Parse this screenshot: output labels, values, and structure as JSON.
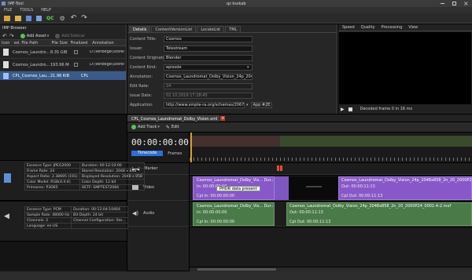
{
  "window": {
    "title": "IMF-Tool",
    "center_title": "qz ksskab"
  },
  "menu": [
    "FILE",
    "TOOLS",
    "HELP"
  ],
  "imp_browser": {
    "title": "IMP Browser",
    "add_asset": "Add Asset",
    "add_sidecar": "Add Sidecar",
    "columns": [
      "Icon",
      "ed. File Path",
      "File Size",
      "Finalized",
      "Annotation"
    ],
    "rows": [
      {
        "name": "Cosmos_Laundro...",
        "size": "8.35 GiB",
        "annotation": "D:\\Verbege\\Store\\Cosmos_Laundromat"
      },
      {
        "name": "Cosmos_Laundro...",
        "size": "193.96 MiB",
        "annotation": "D:\\Verbege\\Store\\Cosmos_Laundromat"
      },
      {
        "name": "CPL_Cosmos_Lau...",
        "size": "21.96 KiB",
        "annotation": "CPL"
      }
    ]
  },
  "details": {
    "tabs": [
      "Details",
      "ContentVersionList",
      "LocaleList",
      "TML"
    ],
    "fields": [
      {
        "label": "Content Title:",
        "value": "Cosmos"
      },
      {
        "label": "Issuer:",
        "value": "Telestream"
      },
      {
        "label": "Content Originator:",
        "value": "Blender"
      },
      {
        "label": "Content Kind:",
        "value": "episode"
      },
      {
        "label": "Annotation:",
        "value": "Cosmos_Laundromat_Dolby_Vision_24p_2048x858"
      },
      {
        "label": "Edit Rate:",
        "value": "24"
      },
      {
        "label": "Issue Date:",
        "value": "02.10.2019 17:28:45"
      },
      {
        "label": "Application:",
        "value": "http://www.smpte-ra.org/schemas/2067-21/2016"
      }
    ],
    "app_value": "App #2E"
  },
  "player": {
    "tabs": [
      "Speed",
      "Quality",
      "Processing",
      "View"
    ],
    "status": "Decoded frame 0 in 16 ms"
  },
  "timeline": {
    "tab": "CPL_Cosmos_Laundromat_Dolby_Vision.xml",
    "add_track": "Add Track",
    "edit": "Edit",
    "timecode": "00:00:00:00",
    "timecode_tab": "Timecode",
    "frames_tab": "Frames",
    "tracks": [
      "Marker",
      "Video",
      "Audio"
    ],
    "video_clips": [
      {
        "title": "Cosmos_Laundromat_Dolby_Vis... Dur.: 264",
        "sub": "In: 00:00:00:00"
      },
      {
        "title": "Cosmos_Laundromat_Dolby_Vision_24p_2048x858_2n_20_2000P24_0001-4.0",
        "sub": "Out: 00:00:11:13"
      }
    ],
    "audio_clips": [
      {
        "title": "Cosmos_Laundromat_Dolby_Vis... Dur.: 264",
        "sub": "In: 00:00:00:00",
        "cpl": "Cpl In: 00:00:00:00"
      },
      {
        "title": "Cosmos_Laundromat_Dolby_Vision_24p_2048x858_2n_20_2000P24_0001-4-2.mxf",
        "sub": "Out: 00:00:11:13",
        "cpl": "Cpl Out: 00:00:11:13"
      }
    ],
    "video_cpl": [
      "Cpl In: 00:00:00:00",
      "Cpl Out: 00:00:11:13"
    ],
    "tooltip": "PHDR data present"
  },
  "essence_video": [
    [
      "Essence Type: JPEG2000",
      "Duration: 00:12:10:00"
    ],
    [
      "Frame Rate: 24",
      "Stored Resolution: 2048 x 858"
    ],
    [
      "Aspect Ratio: 2.38695 (191)",
      "Displayed Resolution: 2048 x 858"
    ],
    [
      "Color Model: RGB(4:4:4)",
      "Color Depth: 12 bit"
    ],
    [
      "Primaries: P3D65",
      "OETF: SMPTEST2084"
    ]
  ],
  "essence_audio": [
    [
      "Essence Type: PCM",
      "Duration: 00:12:04:10464"
    ],
    [
      "Sample Rate: 48000 Hz",
      "Bit Depth: 24 bit"
    ],
    [
      "Channels: 2",
      "Channel Configuration: Ste..."
    ],
    [
      "Language: en-US",
      ""
    ]
  ]
}
